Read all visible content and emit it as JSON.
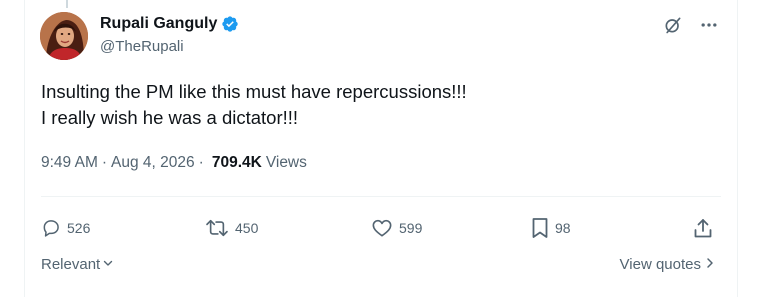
{
  "author": {
    "display_name": "Rupali Ganguly",
    "handle": "@TheRupali",
    "verified_icon": "verified-badge-icon",
    "avatar": "profile-photo"
  },
  "header_icons": [
    "grok-icon",
    "more-icon"
  ],
  "tweet": {
    "lines": [
      "Insulting the PM like this must have repercussions!!!",
      "I really wish he was a dictator!!!"
    ]
  },
  "meta": {
    "time": "9:49 AM",
    "separator": "·",
    "date": "Aug 4, 2026",
    "views_count": "709.4K",
    "views_label": "Views"
  },
  "actions": {
    "replies": "526",
    "reposts": "450",
    "likes": "599",
    "bookmarks": "98"
  },
  "footer": {
    "sort_label": "Relevant",
    "view_quotes_label": "View quotes"
  },
  "colors": {
    "verified": "#1d9bf0",
    "secondary_text": "#536471",
    "primary_text": "#0f1419"
  }
}
